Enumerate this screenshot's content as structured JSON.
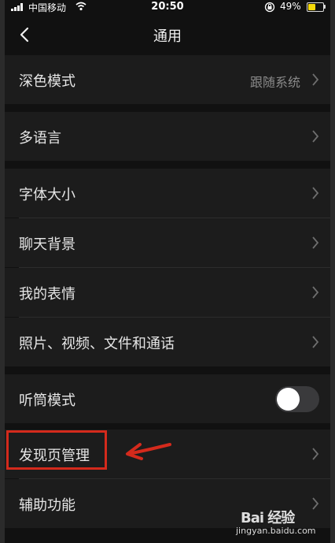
{
  "status_bar": {
    "carrier": "中国移动",
    "time": "20:50",
    "battery_percent": "49%",
    "battery_level": 0.49
  },
  "nav": {
    "title": "通用",
    "back_icon": "chevron-left-icon"
  },
  "rows": {
    "dark_mode": {
      "label": "深色模式",
      "value": "跟随系统"
    },
    "language": {
      "label": "多语言"
    },
    "font_size": {
      "label": "字体大小"
    },
    "chat_background": {
      "label": "聊天背景"
    },
    "my_stickers": {
      "label": "我的表情"
    },
    "media_files": {
      "label": "照片、视频、文件和通话"
    },
    "earpiece_mode": {
      "label": "听筒模式",
      "toggle_on": false
    },
    "discover_manage": {
      "label": "发现页管理"
    },
    "accessibility": {
      "label": "辅助功能"
    }
  },
  "annotation": {
    "box_color": "#d42a1c"
  },
  "watermark": {
    "brand": "Bai 经验",
    "url": "jingyan.baidu.com"
  }
}
